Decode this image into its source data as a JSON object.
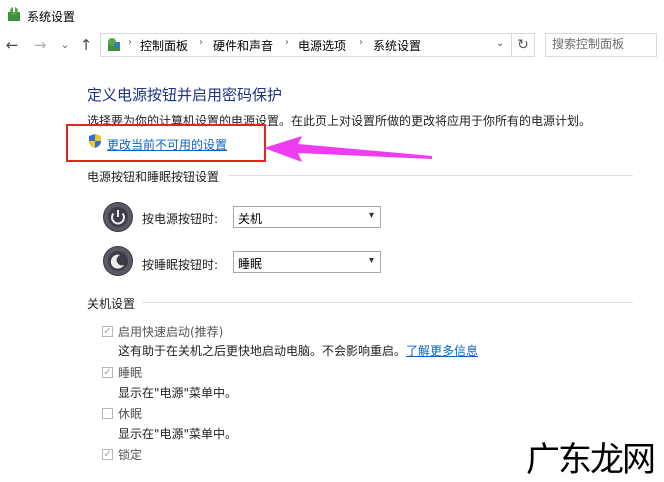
{
  "window": {
    "title": "系统设置",
    "title_icon": "power-options-icon"
  },
  "nav": {
    "back": "←",
    "forward": "→",
    "dropdown": "⌄",
    "up": "↑"
  },
  "address": {
    "crumbs": [
      "控制面板",
      "硬件和声音",
      "电源选项",
      "系统设置"
    ],
    "separator": "›",
    "dropdown": "⌄",
    "refresh": "↻"
  },
  "search": {
    "placeholder": "搜索控制面板"
  },
  "page": {
    "title": "定义电源按钮并启用密码保护",
    "description": "选择要为你的计算机设置的电源设置。在此页上对设置所做的更改将应用于你所有的电源计划。",
    "change_link": "更改当前不可用的设置"
  },
  "buttons_section": {
    "header": "电源按钮和睡眠按钮设置",
    "rows": [
      {
        "label": "按电源按钮时:",
        "value": "关机",
        "icon": "power-button-icon"
      },
      {
        "label": "按睡眠按钮时:",
        "value": "睡眠",
        "icon": "sleep-button-icon"
      }
    ]
  },
  "shutdown_section": {
    "header": "关机设置",
    "options": [
      {
        "label": "启用快速启动(推荐)",
        "checked": true,
        "desc": "这有助于在关机之后更快地启动电脑。不会影响重启。",
        "link": "了解更多信息"
      },
      {
        "label": "睡眠",
        "checked": true,
        "desc": "显示在\"电源\"菜单中。"
      },
      {
        "label": "休眠",
        "checked": false,
        "desc": "显示在\"电源\"菜单中。"
      },
      {
        "label": "锁定",
        "checked": true
      }
    ]
  },
  "watermark": "广东龙网",
  "colors": {
    "title": "#1e3287",
    "link": "#0a64c8",
    "highlight_box": "#e8211a",
    "arrow": "#f03cf0"
  }
}
